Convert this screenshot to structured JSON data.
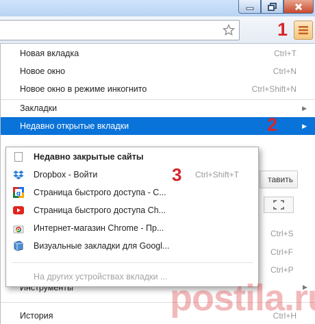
{
  "toolbar": {
    "menu_icon": "hamburger-menu-icon",
    "bookmark_icon": "star-icon"
  },
  "annotations": {
    "one": "1",
    "two": "2",
    "three": "3"
  },
  "menu": {
    "items": [
      {
        "label": "Новая вкладка",
        "shortcut": "Ctrl+T"
      },
      {
        "label": "Новое окно",
        "shortcut": "Ctrl+N"
      },
      {
        "label": "Новое окно в режиме инкогнито",
        "shortcut": "Ctrl+Shift+N"
      },
      {
        "label": "Закладки",
        "shortcut": ""
      },
      {
        "label": "Недавно открытые вкладки",
        "shortcut": ""
      }
    ],
    "partial": {
      "restore_button": "тавить",
      "shortcut_s": "Ctrl+S",
      "shortcut_f": "Ctrl+F",
      "shortcut_p": "Ctrl+P",
      "tools_label": "Инструменты",
      "history_label": "История",
      "history_shortcut": "Ctrl+H"
    }
  },
  "submenu": {
    "header": "Недавно закрытые сайты",
    "items": [
      {
        "label": "Dropbox - Войти",
        "shortcut": "Ctrl+Shift+T",
        "icon": "dropbox-icon"
      },
      {
        "label": "Страница быстрого доступа - С...",
        "shortcut": "",
        "icon": "google-icon"
      },
      {
        "label": "Страница быстрого доступа Ch...",
        "shortcut": "",
        "icon": "youtube-icon"
      },
      {
        "label": "Интернет-магазин Chrome - Пр...",
        "shortcut": "",
        "icon": "chrome-store-icon"
      },
      {
        "label": "Визуальные закладки для Googl...",
        "shortcut": "",
        "icon": "visual-bookmarks-icon"
      }
    ],
    "other_devices": "На других устройствах вкладки ..."
  },
  "colors": {
    "highlight": "#0a73d9",
    "annotation_red": "#d6262a",
    "menu_button": "#f6c67f"
  }
}
